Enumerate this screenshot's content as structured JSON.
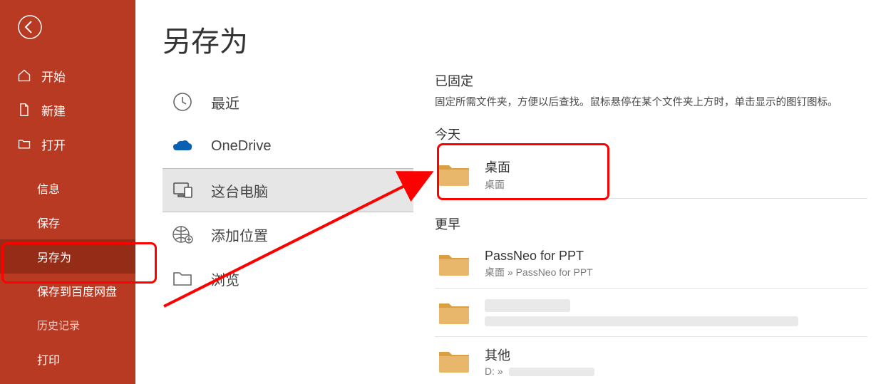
{
  "sidebar": {
    "back_aria": "返回",
    "items": [
      {
        "label": "开始"
      },
      {
        "label": "新建"
      },
      {
        "label": "打开"
      },
      {
        "label": "信息"
      },
      {
        "label": "保存"
      },
      {
        "label": "另存为"
      },
      {
        "label": "保存到百度网盘"
      },
      {
        "label": "历史记录"
      },
      {
        "label": "打印"
      }
    ]
  },
  "page": {
    "title": "另存为"
  },
  "locations": {
    "recent": "最近",
    "onedrive": "OneDrive",
    "thispc": "这台电脑",
    "addplace": "添加位置",
    "browse": "浏览"
  },
  "right": {
    "pinned_title": "已固定",
    "pinned_sub": "固定所需文件夹，方便以后查找。鼠标悬停在某个文件夹上方时，单击显示的图钉图标。",
    "today_title": "今天",
    "earlier_title": "更早",
    "folders": {
      "desktop": {
        "name": "桌面",
        "path": "桌面"
      },
      "passneo": {
        "name": "PassNeo for PPT",
        "path": "桌面 » PassNeo for PPT"
      },
      "other": {
        "name": "其他",
        "path_prefix": "D: »"
      }
    }
  }
}
